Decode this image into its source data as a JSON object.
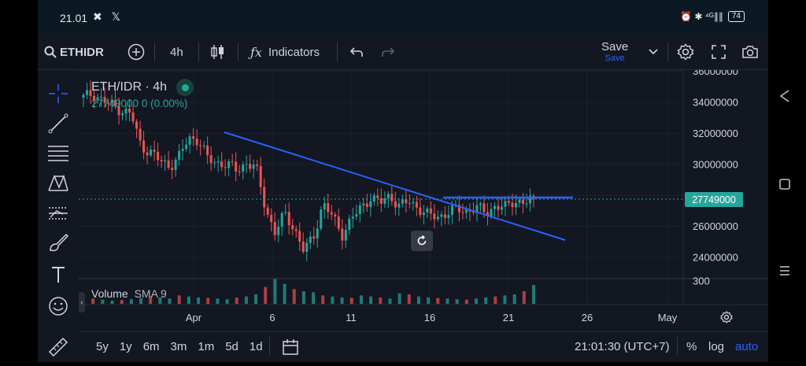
{
  "status": {
    "time": "21.01",
    "notif_icons": "✖ 𝕏",
    "net": "⏰ ✱ ⁴ᴳ∥∥",
    "battery": "74"
  },
  "toolbar": {
    "symbol": "ETHIDR",
    "interval": "4h",
    "indicators_label": "Indicators",
    "save_label": "Save",
    "save_sub": "Save"
  },
  "legend": {
    "title": "ETH/IDR · 4h",
    "ohlc": "27749000  0 (0.00%)",
    "volume_label": "Volume",
    "sma_label": "SMA 9"
  },
  "price_axis": {
    "labels": [
      "36000000",
      "34000000",
      "32000000",
      "30000000",
      "26000000",
      "24000000",
      "300"
    ],
    "current_price": "27749000"
  },
  "time_axis": {
    "labels": [
      "Apr",
      "6",
      "11",
      "16",
      "21",
      "26",
      "May"
    ]
  },
  "bottom_bar": {
    "ranges": [
      "5y",
      "1y",
      "6m",
      "3m",
      "1m",
      "5d",
      "1d"
    ],
    "clock": "21:01:30 (UTC+7)",
    "percent": "%",
    "log": "log",
    "auto": "auto"
  },
  "colors": {
    "up": "#26a69a",
    "down": "#ef5350",
    "trendline": "#2962ff",
    "accent": "#2962ff"
  },
  "chart_data": {
    "type": "candlestick",
    "y_ticks": [
      36000000,
      34000000,
      32000000,
      30000000,
      26000000,
      24000000
    ],
    "ylim": [
      23000000,
      36300000
    ],
    "x_ticks": [
      "Apr",
      "6",
      "11",
      "16",
      "21",
      "26",
      "May"
    ],
    "last_price": 27749000,
    "price_path": [
      34300000,
      34600000,
      34100000,
      33800000,
      33500000,
      33200000,
      31200000,
      30800000,
      30200000,
      29900000,
      30500000,
      31700000,
      31600000,
      30300000,
      30100000,
      30000000,
      29600000,
      30100000,
      29800000,
      27200000,
      25600000,
      26800000,
      25900000,
      24400000,
      25300000,
      27500000,
      26600000,
      25500000,
      26500000,
      27200000,
      27900000,
      27500000,
      28000000,
      27300000,
      27600000,
      27200000,
      26700000,
      26600000,
      26900000,
      27100000,
      27000000,
      27200000,
      26900000,
      27300000,
      27200000,
      27700000,
      27500000,
      27749000
    ],
    "volume_scale_top": 300,
    "volume": [
      30,
      25,
      20,
      15,
      18,
      22,
      28,
      35,
      30,
      25,
      40,
      35,
      30,
      28,
      25,
      22,
      30,
      35,
      45,
      80,
      120,
      95,
      70,
      60,
      55,
      40,
      35,
      30,
      28,
      40,
      35,
      30,
      25,
      50,
      45,
      35,
      30,
      28,
      25,
      22,
      20,
      25,
      30,
      35,
      40,
      45,
      60,
      90
    ]
  }
}
